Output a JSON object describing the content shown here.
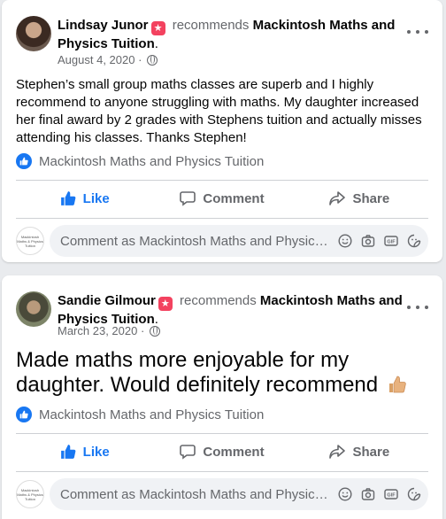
{
  "posts": [
    {
      "author": "Lindsay Junor",
      "recommends": "recommends",
      "page": "Mackintosh Maths and Physics Tuition",
      "date": "August 4, 2020",
      "text": "Stephen’s small group maths classes are superb and I highly recommend to anyone struggling with maths. My daughter increased her final award by 2 grades with Stephens tuition and actually misses attending his classes. Thanks Stephen!",
      "liked_by": "Mackintosh Maths and Physics Tuition"
    },
    {
      "author": "Sandie Gilmour",
      "recommends": "recommends",
      "page": "Mackintosh Maths and Physics Tuition",
      "date": "March 23, 2020",
      "text": "Made maths more enjoyable for my daughter. Would definitely recommend",
      "emoji": "thumbs-up-emoji",
      "liked_by": "Mackintosh Maths and Physics Tuition"
    }
  ],
  "actions": {
    "like": "Like",
    "comment": "Comment",
    "share": "Share"
  },
  "comment_placeholder": "Comment as Mackintosh Maths and Physics Tuition",
  "commenter_avatar_text": "Mackintosh Maths & Physics Tuition",
  "icons": [
    "more-options-icon",
    "globe-icon",
    "like-icon",
    "comment-icon",
    "share-icon",
    "emoji-icon",
    "camera-icon",
    "gif-icon",
    "sticker-icon",
    "recommend-badge-icon"
  ],
  "colors": {
    "accent": "#1877f2",
    "badge": "#f3425f",
    "muted": "#65676b"
  }
}
